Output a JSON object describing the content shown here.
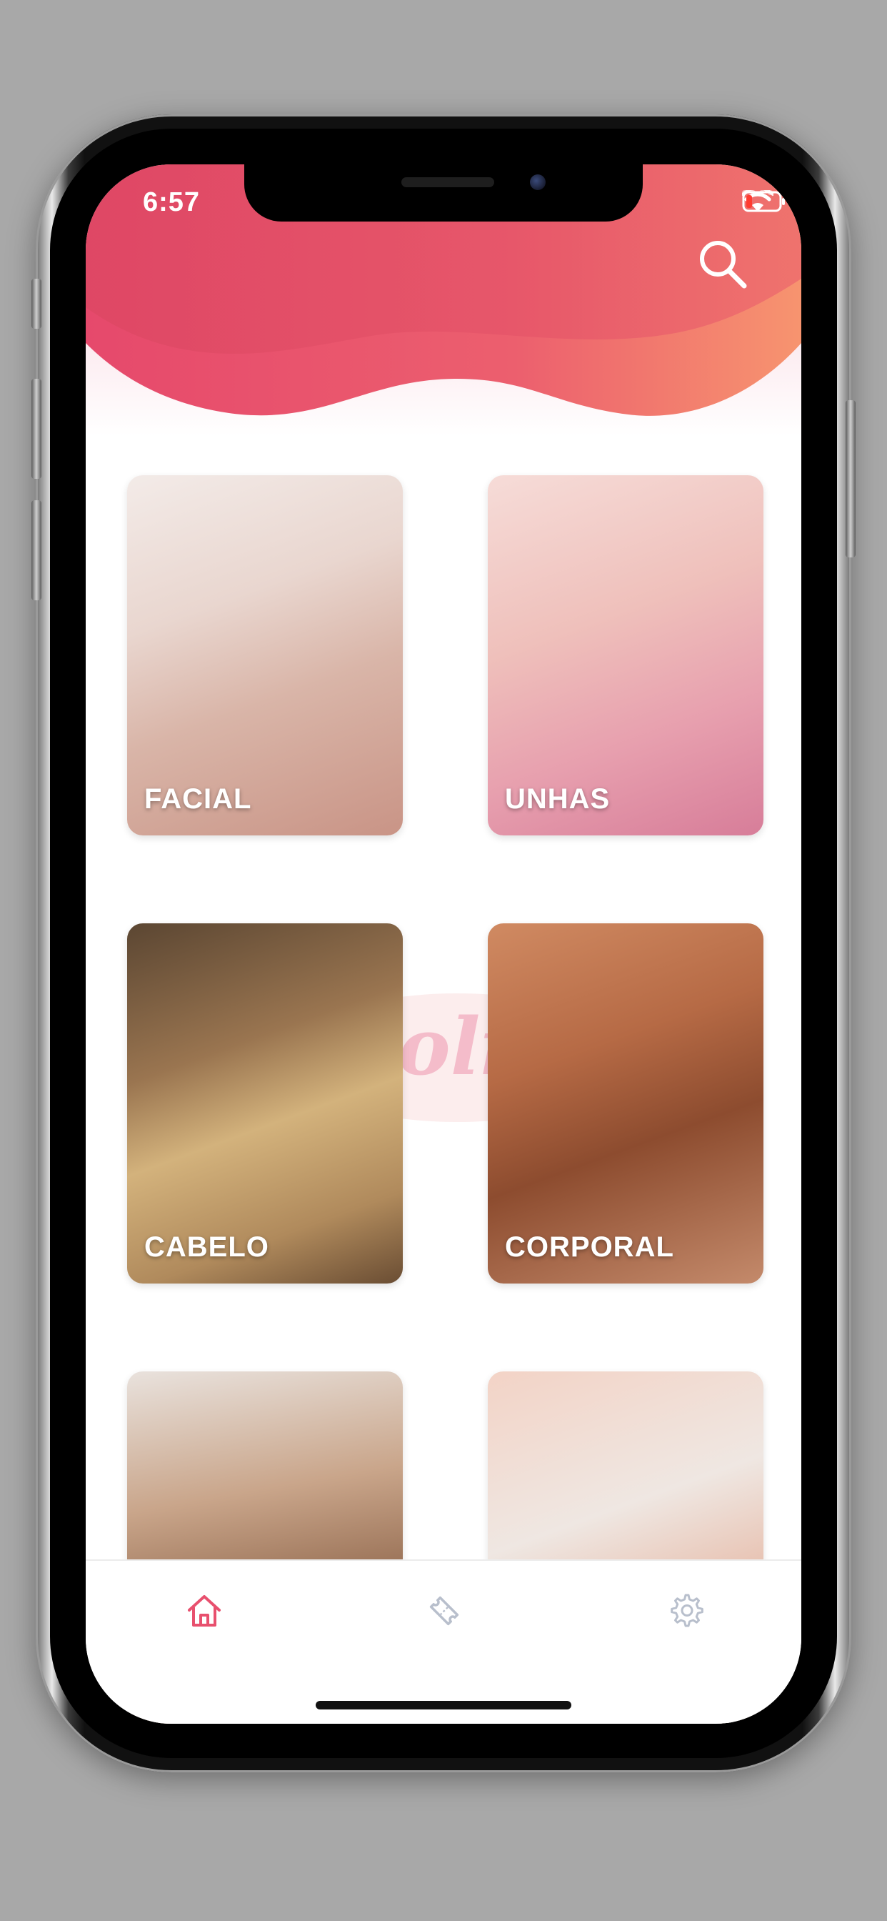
{
  "status_bar": {
    "time": "6:57"
  },
  "header": {
    "search_icon": "search-icon",
    "accent_colors": [
      "#e8506e",
      "#f58a6e"
    ]
  },
  "categories": [
    {
      "label": "FACIAL"
    },
    {
      "label": "UNHAS"
    },
    {
      "label": "CABELO"
    },
    {
      "label": "CORPORAL"
    },
    {
      "label": ""
    },
    {
      "label": ""
    }
  ],
  "watermark": {
    "text": "Lolita"
  },
  "tabbar": {
    "items": [
      {
        "icon": "home-icon",
        "active": true,
        "color": "#e8506e"
      },
      {
        "icon": "ticket-icon",
        "active": false,
        "color": "#b8bfcc"
      },
      {
        "icon": "gear-icon",
        "active": false,
        "color": "#b8bfcc"
      }
    ]
  }
}
